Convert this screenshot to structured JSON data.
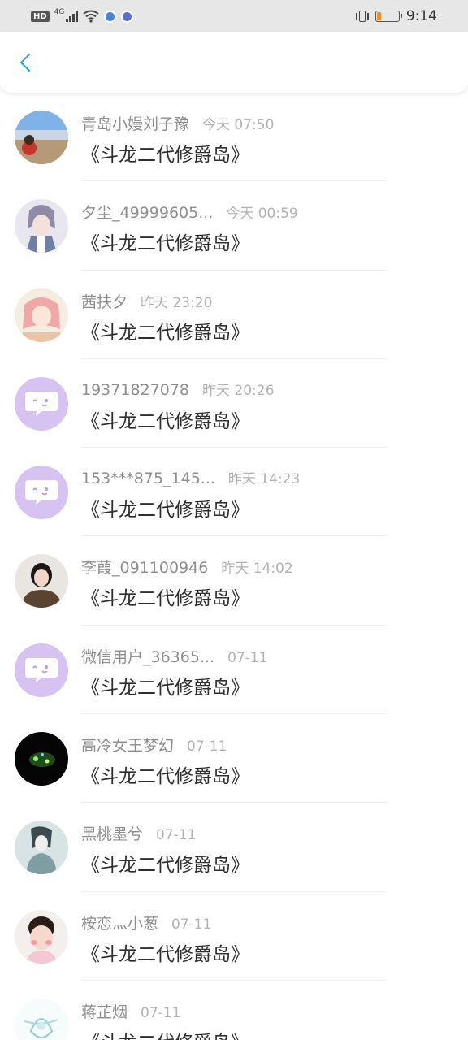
{
  "status_bar": {
    "hd_label": "HD",
    "network_label": "4G",
    "time": "9:14",
    "battery_level": 0.2,
    "battery_color": "#f08b2e"
  },
  "header": {
    "back_icon": "chevron-left-icon",
    "accent_color": "#2f9be8"
  },
  "items": [
    {
      "name": "青岛小嫚刘子豫",
      "time": "今天 07:50",
      "message": "《斗龙二代修爵岛》",
      "avatar": "beach-photo"
    },
    {
      "name": "夕尘_49999605...",
      "time": "今天 00:59",
      "message": "《斗龙二代修爵岛》",
      "avatar": "anime-boy"
    },
    {
      "name": "茜扶夕",
      "time": "昨天 23:20",
      "message": "《斗龙二代修爵岛》",
      "avatar": "anime-girl-pink"
    },
    {
      "name": "19371827078",
      "time": "昨天 20:26",
      "message": "《斗龙二代修爵岛》",
      "avatar": "default-chat-bubble"
    },
    {
      "name": "153***875_145...",
      "time": "昨天 14:23",
      "message": "《斗龙二代修爵岛》",
      "avatar": "default-chat-bubble"
    },
    {
      "name": "李葭_091100946",
      "time": "昨天 14:02",
      "message": "《斗龙二代修爵岛》",
      "avatar": "girl-photo"
    },
    {
      "name": "微信用户_36365...",
      "time": "07-11",
      "message": "《斗龙二代修爵岛》",
      "avatar": "default-chat-bubble"
    },
    {
      "name": "高冷女王梦幻",
      "time": "07-11",
      "message": "《斗龙二代修爵岛》",
      "avatar": "dark-glow"
    },
    {
      "name": "黑桃墨兮",
      "time": "07-11",
      "message": "《斗龙二代修爵岛》",
      "avatar": "ink-painting"
    },
    {
      "name": "桉恋灬小葱",
      "time": "07-11",
      "message": "《斗龙二代修爵岛》",
      "avatar": "child-photo"
    },
    {
      "name": "蒋芷烟",
      "time": "07-11",
      "message": "《斗龙二代修爵岛》",
      "avatar": "sketch-flower"
    }
  ]
}
